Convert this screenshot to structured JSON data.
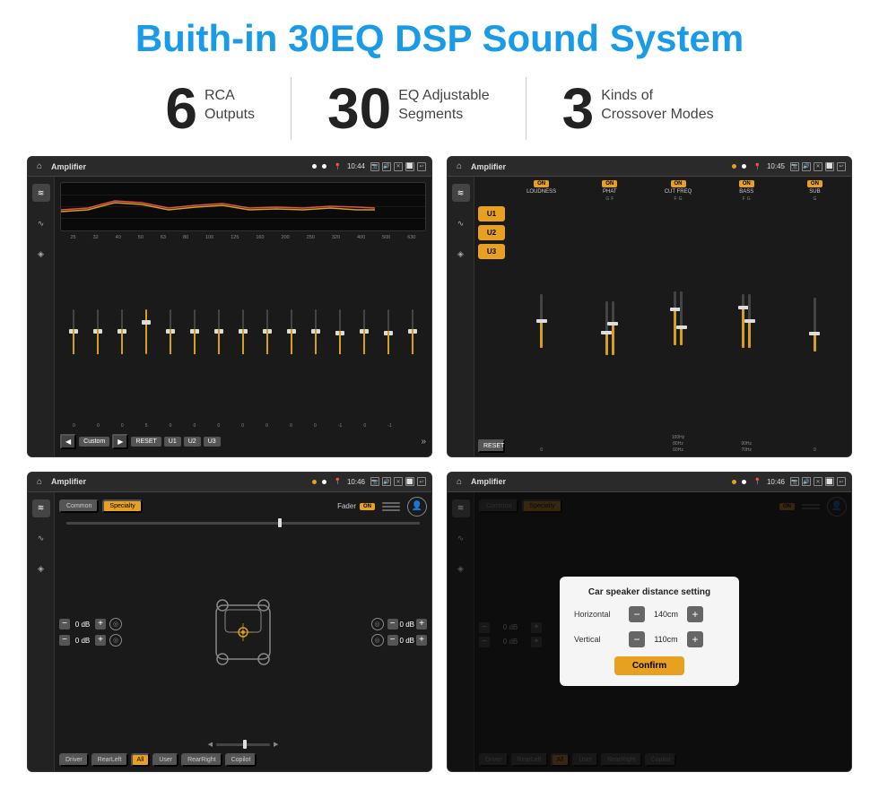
{
  "page": {
    "title": "Buith-in 30EQ DSP Sound System",
    "bg_color": "#ffffff"
  },
  "stats": [
    {
      "number": "6",
      "label": "RCA\nOutputs"
    },
    {
      "number": "30",
      "label": "EQ Adjustable\nSegments"
    },
    {
      "number": "3",
      "label": "Kinds of\nCrossover Modes"
    }
  ],
  "screens": {
    "eq": {
      "topbar": {
        "title": "Amplifier",
        "time": "10:44"
      },
      "freq_labels": [
        "25",
        "32",
        "40",
        "50",
        "63",
        "80",
        "100",
        "125",
        "160",
        "200",
        "250",
        "320",
        "400",
        "500",
        "630"
      ],
      "slider_values": [
        "0",
        "0",
        "0",
        "5",
        "0",
        "0",
        "0",
        "0",
        "0",
        "0",
        "0",
        "-1",
        "0",
        "-1"
      ],
      "buttons": [
        "Custom",
        "RESET",
        "U1",
        "U2",
        "U3"
      ]
    },
    "crossover": {
      "topbar": {
        "title": "Amplifier",
        "time": "10:45"
      },
      "presets": [
        "U1",
        "U2",
        "U3"
      ],
      "channels": [
        "LOUDNESS",
        "PHAT",
        "CUT FREQ",
        "BASS",
        "SUB"
      ],
      "reset_label": "RESET"
    },
    "fader": {
      "topbar": {
        "title": "Amplifier",
        "time": "10:46"
      },
      "tabs": [
        "Common",
        "Specialty"
      ],
      "fader_label": "Fader",
      "on_label": "ON",
      "db_values": [
        "0 dB",
        "0 dB",
        "0 dB",
        "0 dB"
      ],
      "bottom_buttons": [
        "Driver",
        "RearLeft",
        "All",
        "User",
        "RearRight",
        "Copilot"
      ]
    },
    "distance": {
      "topbar": {
        "title": "Amplifier",
        "time": "10:46"
      },
      "tabs": [
        "Common",
        "Specialty"
      ],
      "on_label": "ON",
      "dialog": {
        "title": "Car speaker distance setting",
        "horizontal_label": "Horizontal",
        "horizontal_value": "140cm",
        "vertical_label": "Vertical",
        "vertical_value": "110cm",
        "confirm_label": "Confirm",
        "minus_label": "−",
        "plus_label": "+"
      },
      "db_values": [
        "0 dB",
        "0 dB"
      ],
      "bottom_buttons": [
        "Driver",
        "RearLeft",
        "All",
        "User",
        "RearRight",
        "Copilot"
      ]
    }
  },
  "icons": {
    "home": "⌂",
    "equalizer": "≋",
    "waveform": "∿",
    "speaker": "◈",
    "location": "📍",
    "camera": "📷",
    "volume": "🔊",
    "back": "↩",
    "menu": "☰",
    "play": "▶",
    "pause": "⏸",
    "prev": "◀",
    "next": "▶▶",
    "expand": "»"
  }
}
